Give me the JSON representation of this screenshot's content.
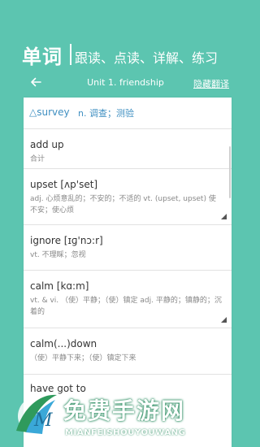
{
  "banner": {
    "title": "单词",
    "subtitle": "跟读、点读、详解、练习"
  },
  "navbar": {
    "back_icon": "back-arrow-icon",
    "title": "Unit 1. friendship",
    "toggle_label": "隐藏翻译"
  },
  "header_word": {
    "word": "△survey",
    "definition": "n. 调查；测验"
  },
  "entries": [
    {
      "word": "add up",
      "meaning": "合计"
    },
    {
      "word": "upset  [ʌp'set]",
      "meaning": "adj. 心烦意乱的；不安的；不适的 vt. (upset, upset) 使不安；使心烦"
    },
    {
      "word": "ignore  [ɪɡ'nɔ:r]",
      "meaning": "vt. 不理睬；忽视"
    },
    {
      "word": "calm  [kɑ:m]",
      "meaning": "vt. & vi. （使）平静；（使）镇定 adj. 平静的；镇静的；沉着的"
    },
    {
      "word": "calm(...)down",
      "meaning": "（使）平静下来；（使）镇定下来"
    },
    {
      "word": "have got to",
      "meaning": ""
    }
  ],
  "watermark": {
    "text": "免费手游网",
    "url": "MIANFEISHOUYOUWANG"
  },
  "colors": {
    "background": "#5cc5b0",
    "accent": "#3f8fc1",
    "word": "#333333",
    "meaning": "#888888"
  }
}
